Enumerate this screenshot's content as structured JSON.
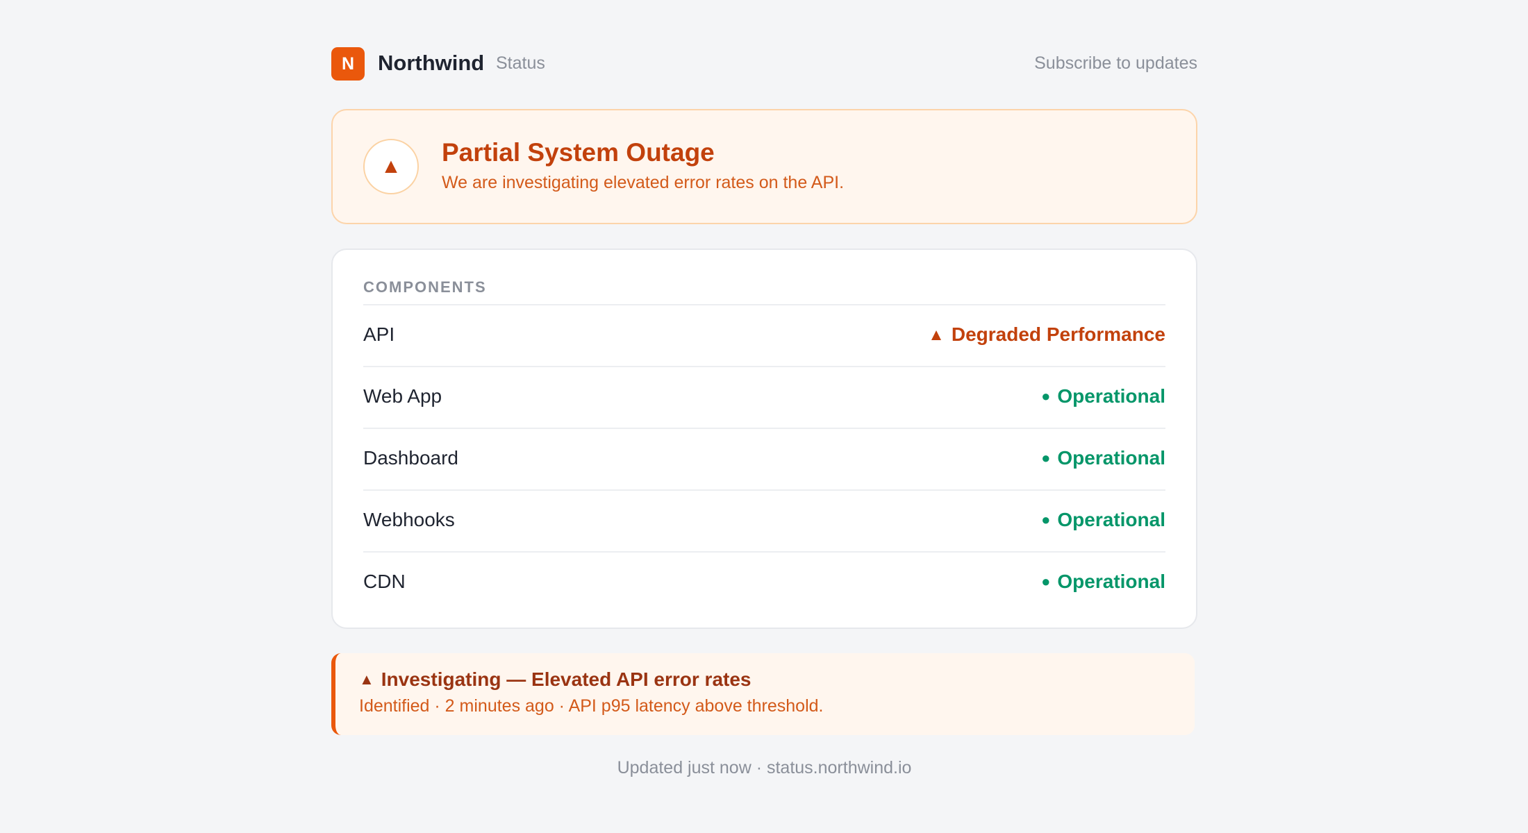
{
  "brand": {
    "logo_letter": "N",
    "name": "Northwind",
    "sub": "Status"
  },
  "header": {
    "subscribe_label": "Subscribe to updates"
  },
  "banner": {
    "icon": "warning-triangle-icon",
    "icon_glyph": "▲",
    "title": "Partial System Outage",
    "description": "We are investigating elevated error rates on the API."
  },
  "components": {
    "title": "COMPONENTS",
    "items": [
      {
        "name": "API",
        "status": "Degraded Performance",
        "glyph": "▲",
        "level": "warn"
      },
      {
        "name": "Web App",
        "status": "Operational",
        "glyph": "●",
        "level": "ok"
      },
      {
        "name": "Dashboard",
        "status": "Operational",
        "glyph": "●",
        "level": "ok"
      },
      {
        "name": "Webhooks",
        "status": "Operational",
        "glyph": "●",
        "level": "ok"
      },
      {
        "name": "CDN",
        "status": "Operational",
        "glyph": "●",
        "level": "ok"
      }
    ]
  },
  "incident": {
    "glyph": "▲",
    "title": "Investigating — Elevated API error rates",
    "meta": "Identified · 2 minutes ago · API p95 latency above threshold."
  },
  "footer": {
    "text": "Updated just now · status.northwind.io"
  },
  "colors": {
    "accent": "#ea580c",
    "warning_text": "#c2410c",
    "operational": "#059669",
    "background": "#f4f5f7"
  }
}
